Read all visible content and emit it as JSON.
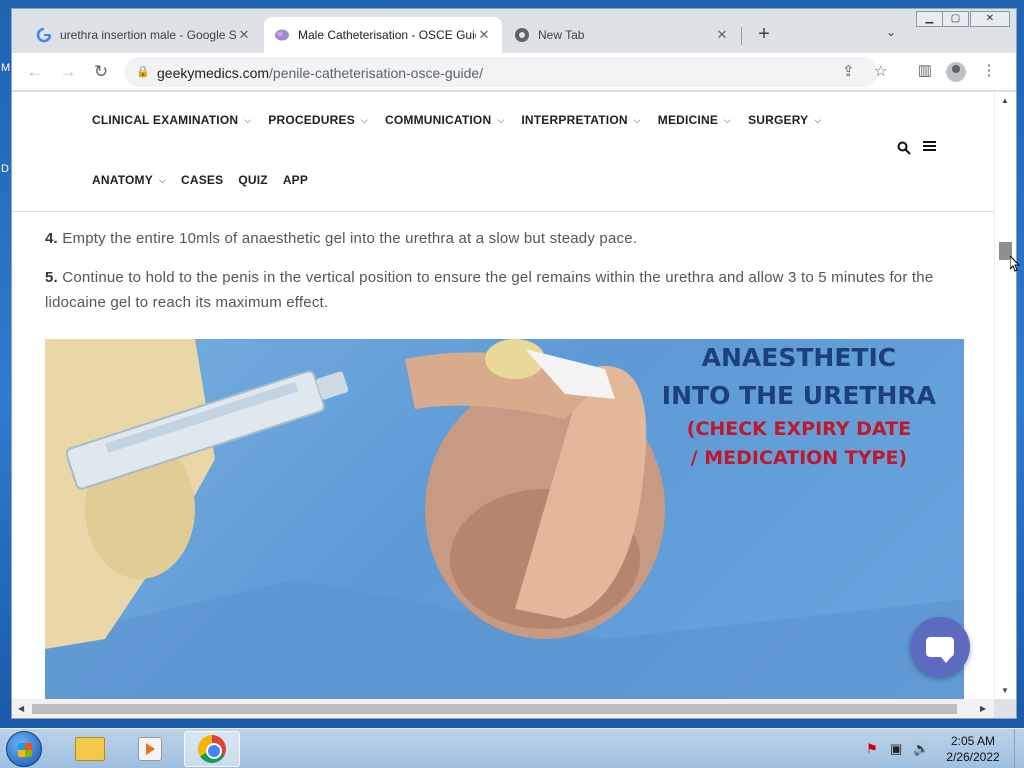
{
  "desktop": {
    "letters": [
      "M",
      "D"
    ]
  },
  "tabs": [
    {
      "title": "urethra insertion male - Google S",
      "icon": "google-icon",
      "active": false
    },
    {
      "title": "Male Catheterisation - OSCE Guid",
      "icon": "geekymedics-icon",
      "active": true
    },
    {
      "title": "New Tab",
      "icon": "chrome-icon",
      "active": false
    }
  ],
  "url": {
    "domain": "geekymedics.com",
    "path": "/penile-catheterisation-osce-guide/"
  },
  "nav": {
    "row1": [
      {
        "label": "CLINICAL EXAMINATION",
        "dropdown": true
      },
      {
        "label": "PROCEDURES",
        "dropdown": true
      },
      {
        "label": "COMMUNICATION",
        "dropdown": true
      },
      {
        "label": "INTERPRETATION",
        "dropdown": true
      },
      {
        "label": "MEDICINE",
        "dropdown": true
      },
      {
        "label": "SURGERY",
        "dropdown": true
      }
    ],
    "row2": [
      {
        "label": "ANATOMY",
        "dropdown": true
      },
      {
        "label": "CASES",
        "dropdown": false
      },
      {
        "label": "QUIZ",
        "dropdown": false
      },
      {
        "label": "APP",
        "dropdown": false
      }
    ]
  },
  "article": {
    "steps": [
      {
        "num": "4.",
        "text": "Empty the entire 10mls of anaesthetic gel into the urethra at a slow but steady pace."
      },
      {
        "num": "5.",
        "text": "Continue to hold to the penis in the vertical position to ensure the gel remains within the urethra and allow 3 to 5 minutes for the lidocaine gel to reach its maximum effect."
      }
    ],
    "image_caption": {
      "line1": "ANAESTHETIC",
      "line2": "INTO THE URETHRA",
      "line3": "(CHECK EXPIRY DATE",
      "line4": "/ MEDICATION TYPE)"
    }
  },
  "taskbar": {
    "time": "2:05 AM",
    "date": "2/26/2022"
  },
  "colors": {
    "accent_chat": "#5c6bc0",
    "hero_blue": "#1d3f7a",
    "hero_red": "#c0182a"
  }
}
